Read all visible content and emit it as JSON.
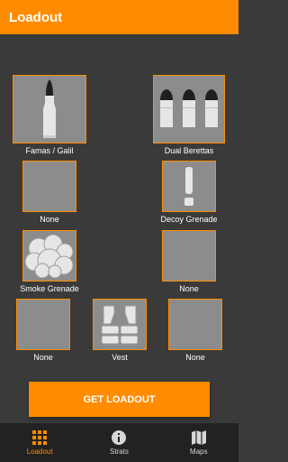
{
  "appbar": {
    "title": "Loadout"
  },
  "slots": {
    "primary": {
      "label": "Famas / Galil",
      "icon": "rifle-bullet-icon"
    },
    "secondary": {
      "label": "Dual Berettas",
      "icon": "pistol-bullets-icon"
    },
    "gear1": {
      "label": "None"
    },
    "gear2": {
      "label": "Decoy Grenade",
      "icon": "decoy-grenade-icon"
    },
    "gear3": {
      "label": "Smoke Grenade",
      "icon": "smoke-cloud-icon"
    },
    "gear4": {
      "label": "None"
    },
    "gear5": {
      "label": "None"
    },
    "armor": {
      "label": "Vest",
      "icon": "vest-icon"
    },
    "gear6": {
      "label": "None"
    }
  },
  "cta": {
    "label": "GET LOADOUT"
  },
  "bottom_nav": [
    {
      "label": "Loadout",
      "icon": "grid-icon",
      "active": true
    },
    {
      "label": "Strats",
      "icon": "info-icon",
      "active": false
    },
    {
      "label": "Maps",
      "icon": "map-icon",
      "active": false
    }
  ],
  "colors": {
    "accent": "#ff8c00",
    "background": "#3a3a3a",
    "slot_fill": "#8c8c8c",
    "nav_bg": "#222222"
  }
}
